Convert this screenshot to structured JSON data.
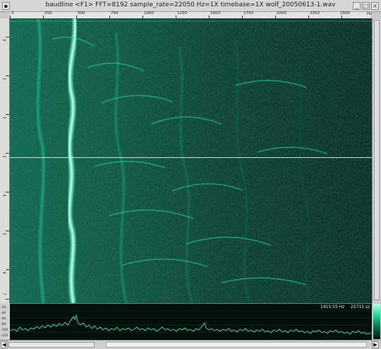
{
  "window": {
    "title": "baudline  <F1> FFT=8192 sample_rate=22050 Hz=1X timebase=1X  wolf_20050613-1.wav",
    "buttons": [
      "_",
      "□",
      "×"
    ]
  },
  "freq_ruler": {
    "labels": [
      "0",
      "250",
      "500",
      "750",
      "1000",
      "1250",
      "1500",
      "1750",
      "2000",
      "2250",
      "2500"
    ],
    "unit": "Hz"
  },
  "time_ruler": {
    "labels": [
      "0",
      "1",
      "2",
      "3",
      "4",
      "5",
      "6",
      "7"
    ]
  },
  "spectrum_panel": {
    "frequency_readout": "1415.55 Hz",
    "sample_readout": "25715 sz",
    "db_labels": [
      "-20",
      "-40",
      "-60",
      "-80",
      "-100",
      "-120"
    ]
  },
  "colors": {
    "spectrogram_bg": "#062a22",
    "signal": "#2af0b0",
    "window_chrome": "#c8c8c8"
  },
  "scrollbar": {
    "left_arrow_icon": "triangle-left",
    "right_arrow_icon": "triangle-right"
  }
}
